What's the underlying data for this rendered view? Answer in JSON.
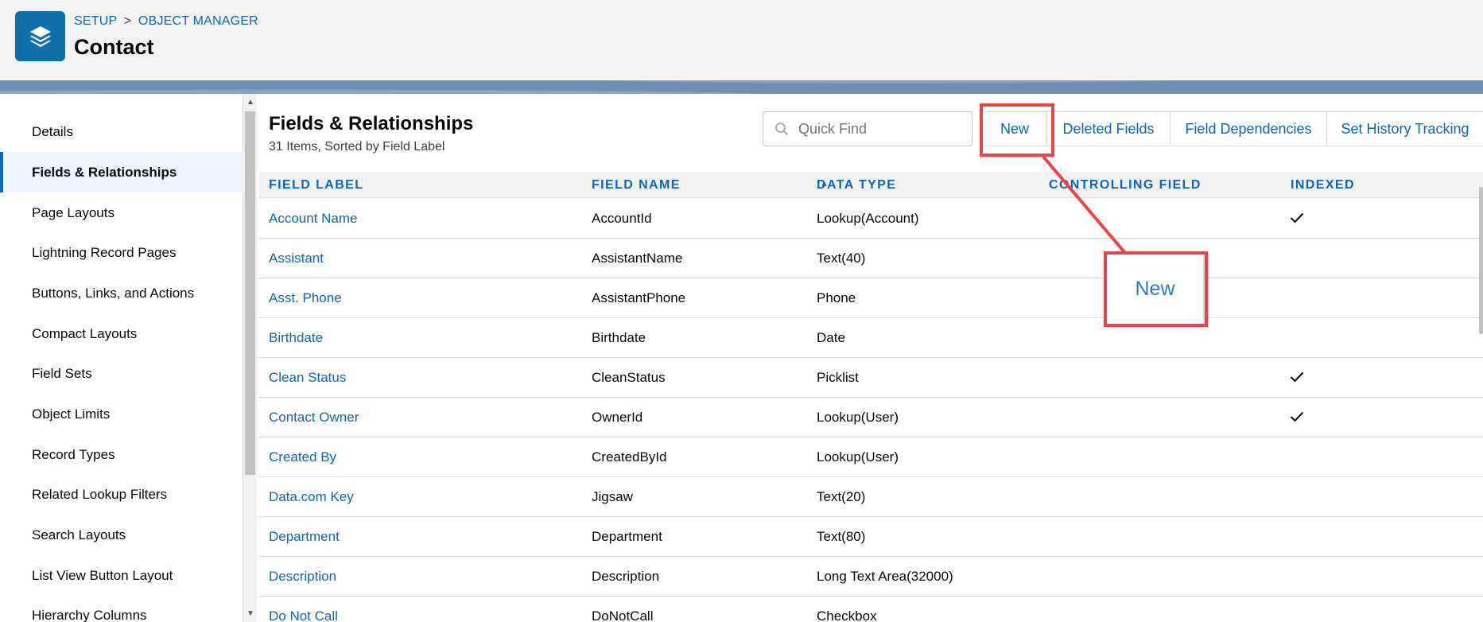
{
  "header": {
    "breadcrumb": {
      "setup": "SETUP",
      "separator": ">",
      "object_manager": "OBJECT MANAGER"
    },
    "title": "Contact",
    "icon": "stacked-layers-icon"
  },
  "sidebar": {
    "items": [
      {
        "label": "Details",
        "active": false
      },
      {
        "label": "Fields & Relationships",
        "active": true
      },
      {
        "label": "Page Layouts",
        "active": false
      },
      {
        "label": "Lightning Record Pages",
        "active": false
      },
      {
        "label": "Buttons, Links, and Actions",
        "active": false
      },
      {
        "label": "Compact Layouts",
        "active": false
      },
      {
        "label": "Field Sets",
        "active": false
      },
      {
        "label": "Object Limits",
        "active": false
      },
      {
        "label": "Record Types",
        "active": false
      },
      {
        "label": "Related Lookup Filters",
        "active": false
      },
      {
        "label": "Search Layouts",
        "active": false
      },
      {
        "label": "List View Button Layout",
        "active": false
      },
      {
        "label": "Hierarchy Columns",
        "active": false
      }
    ]
  },
  "main": {
    "title": "Fields & Relationships",
    "subtitle": "31 Items, Sorted by Field Label",
    "search": {
      "placeholder": "Quick Find",
      "value": ""
    },
    "buttons": {
      "new": "New",
      "deleted_fields": "Deleted Fields",
      "field_dependencies": "Field Dependencies",
      "set_history_tracking": "Set History Tracking"
    },
    "table": {
      "columns": [
        "FIELD LABEL",
        "FIELD NAME",
        "DATA TYPE",
        "CONTROLLING FIELD",
        "INDEXED"
      ],
      "sort": {
        "column": "FIELD LABEL",
        "direction": "ascending"
      },
      "rows": [
        {
          "label": "Account Name",
          "name": "AccountId",
          "type": "Lookup(Account)",
          "controlling": "",
          "indexed": true
        },
        {
          "label": "Assistant",
          "name": "AssistantName",
          "type": "Text(40)",
          "controlling": "",
          "indexed": false
        },
        {
          "label": "Asst. Phone",
          "name": "AssistantPhone",
          "type": "Phone",
          "controlling": "",
          "indexed": false
        },
        {
          "label": "Birthdate",
          "name": "Birthdate",
          "type": "Date",
          "controlling": "",
          "indexed": false
        },
        {
          "label": "Clean Status",
          "name": "CleanStatus",
          "type": "Picklist",
          "controlling": "",
          "indexed": true
        },
        {
          "label": "Contact Owner",
          "name": "OwnerId",
          "type": "Lookup(User)",
          "controlling": "",
          "indexed": true
        },
        {
          "label": "Created By",
          "name": "CreatedById",
          "type": "Lookup(User)",
          "controlling": "",
          "indexed": false
        },
        {
          "label": "Data.com Key",
          "name": "Jigsaw",
          "type": "Text(20)",
          "controlling": "",
          "indexed": false
        },
        {
          "label": "Department",
          "name": "Department",
          "type": "Text(80)",
          "controlling": "",
          "indexed": false
        },
        {
          "label": "Description",
          "name": "Description",
          "type": "Long Text Area(32000)",
          "controlling": "",
          "indexed": false
        },
        {
          "label": "Do Not Call",
          "name": "DoNotCall",
          "type": "Checkbox",
          "controlling": "",
          "indexed": false
        }
      ]
    }
  },
  "callout": {
    "zoom_label": "New",
    "color": "#e8454a"
  },
  "colors": {
    "link": "#0b66b5",
    "header_bg": "#f3f3f3",
    "app_icon": "#0f6fa8",
    "active_item_bg": "#eef4ff"
  }
}
